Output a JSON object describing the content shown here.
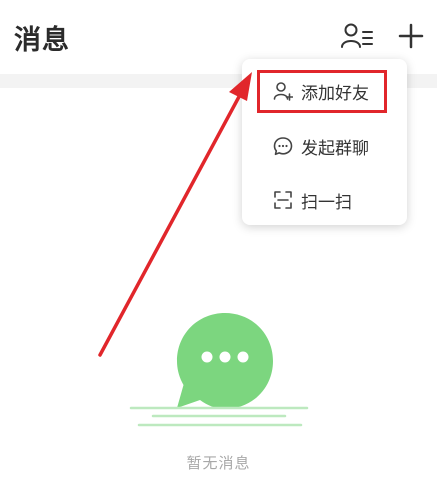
{
  "header": {
    "title": "消息"
  },
  "icons": {
    "contacts": "contacts-list-icon",
    "add": "plus-icon"
  },
  "menu": {
    "items": [
      {
        "label": "添加好友",
        "icon": "person-add-icon"
      },
      {
        "label": "发起群聊",
        "icon": "chat-bubble-icon"
      },
      {
        "label": "扫一扫",
        "icon": "scan-icon"
      }
    ]
  },
  "annotation": {
    "highlight_color": "#e1262b"
  },
  "empty_state": {
    "text": "暂无消息",
    "icon": "chat-bubble-illustration",
    "accent_color": "#7cd67f"
  }
}
